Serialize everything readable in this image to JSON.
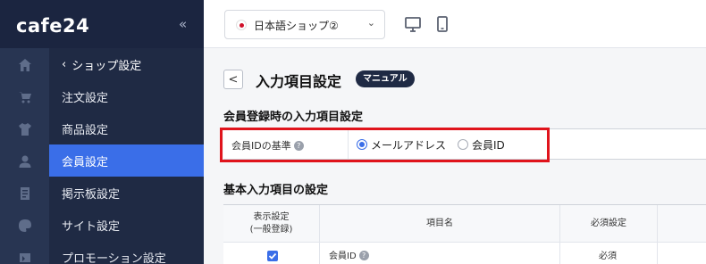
{
  "brand": {
    "logo": "cafe24",
    "collapse_icon": "«"
  },
  "sidebar": {
    "rail_icons": [
      "home-icon",
      "cart-icon",
      "shirt-icon",
      "user-icon",
      "board-icon",
      "palette-icon",
      "promo-icon"
    ],
    "parent_label": "ショップ設定",
    "items": [
      {
        "label": "注文設定"
      },
      {
        "label": "商品設定"
      },
      {
        "label": "会員設定",
        "active": true
      },
      {
        "label": "掲示板設定"
      },
      {
        "label": "サイト設定"
      },
      {
        "label": "プロモーション設定"
      }
    ]
  },
  "topbar": {
    "shop_select": {
      "value": "日本語ショップ②",
      "caret": "⌄"
    },
    "device_icons": [
      "desktop-icon",
      "mobile-icon"
    ]
  },
  "page": {
    "back": "<",
    "title": "入力項目設定",
    "manual_badge": "マニュアル"
  },
  "section1": {
    "title": "会員登録時の入力項目設定",
    "field_label": "会員IDの基準",
    "help": "?",
    "options": [
      {
        "label": "メールアドレス",
        "checked": true
      },
      {
        "label": "会員ID",
        "checked": false
      }
    ]
  },
  "section2": {
    "title": "基本入力項目の設定",
    "headers": [
      "表示設定\n(一般登録)",
      "項目名",
      "必須設定"
    ],
    "rows": [
      {
        "checked": true,
        "name": "会員ID",
        "help": "?",
        "required": "必須"
      }
    ]
  },
  "colors": {
    "accent": "#3a6ee8",
    "sidebar": "#1f2a44",
    "highlight": "#e0141c"
  }
}
